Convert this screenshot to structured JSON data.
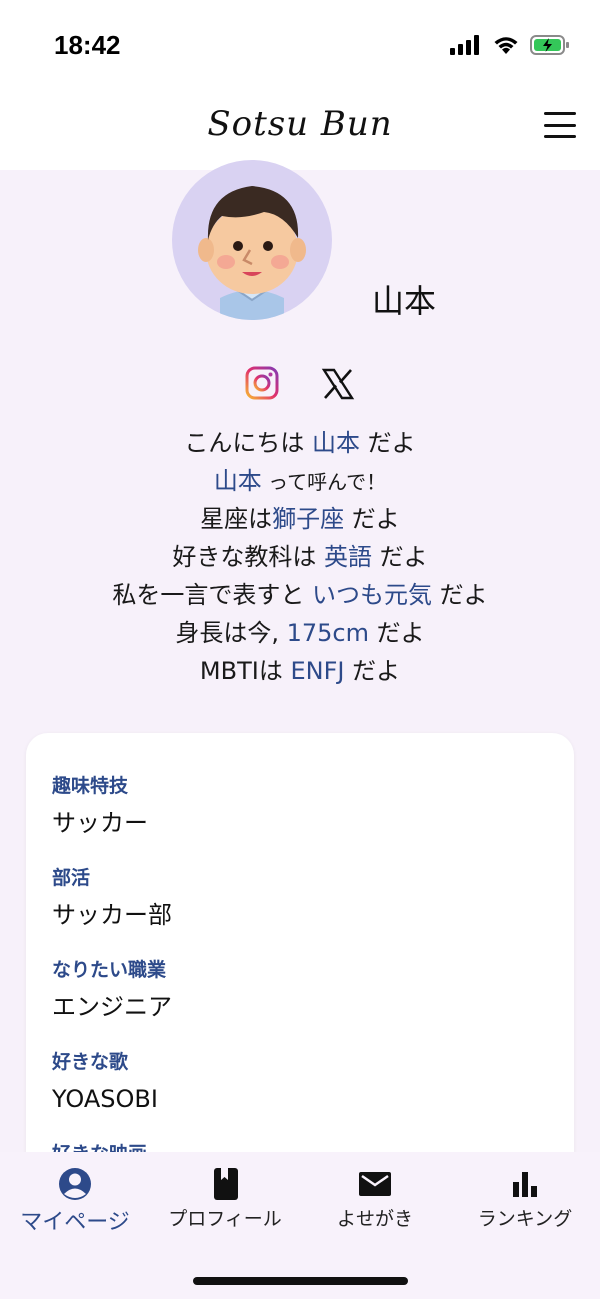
{
  "status_bar": {
    "time": "18:42"
  },
  "header": {
    "app_title": "Sotsu Bun"
  },
  "profile": {
    "name": "山本",
    "social": [
      "instagram-icon",
      "x-icon"
    ],
    "intro": [
      [
        "こんにちは ",
        "山本",
        " だよ"
      ],
      [
        "山本",
        " って呼んで！"
      ],
      [
        "星座は",
        "獅子座",
        " だよ"
      ],
      [
        "好きな教科は ",
        "英語",
        " だよ"
      ],
      [
        "私を一言で表すと ",
        "いつも元気",
        " だよ"
      ],
      [
        "身長は今, ",
        "175cm",
        " だよ"
      ],
      [
        "MBTIは ",
        "ENFJ",
        " だよ"
      ]
    ]
  },
  "info": [
    {
      "label": "趣味特技",
      "value": "サッカー"
    },
    {
      "label": "部活",
      "value": "サッカー部"
    },
    {
      "label": "なりたい職業",
      "value": "エンジニア"
    },
    {
      "label": "好きな歌",
      "value": "YOASOBI"
    },
    {
      "label": "好きな映画",
      "value": ""
    }
  ],
  "nav": {
    "mypage": "マイページ",
    "profile": "プロフィール",
    "messages": "よせがき",
    "ranking": "ランキング"
  },
  "colors": {
    "accent": "#2d4a8a",
    "background": "#f7f1fa",
    "avatar_bg": "#d9d2f2"
  }
}
